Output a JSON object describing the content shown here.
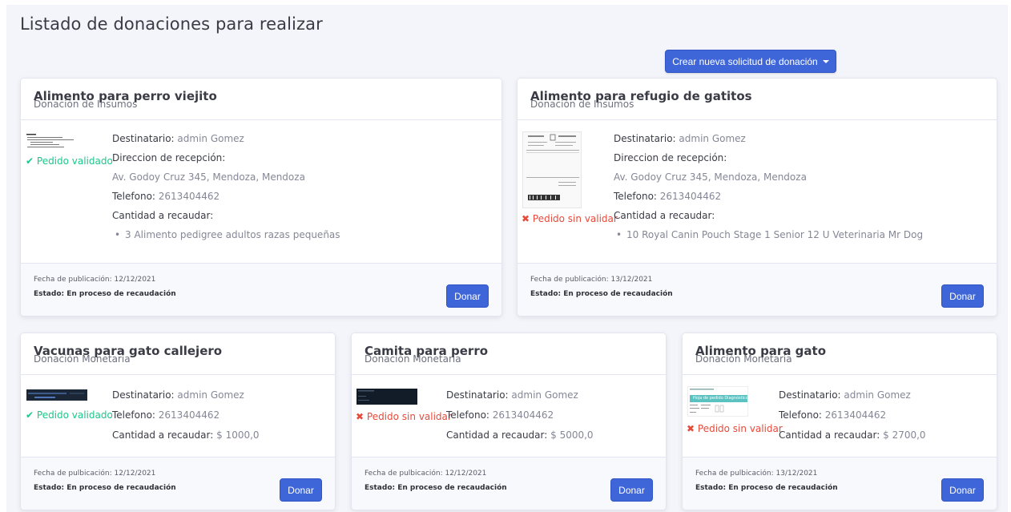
{
  "page": {
    "title": "Listado de donaciones para realizar",
    "create_button_label": "Crear nueva solicitud de donación",
    "donate_label": "Donar",
    "colors": {
      "primary": "#3f66d8",
      "success": "#1cc88a",
      "danger": "#e74a3b",
      "background": "#f3f5fa"
    }
  },
  "cards": [
    {
      "title": "Alimento para perro viejito",
      "subtitle": "Donación de Insumos",
      "status": "Pedido validado",
      "status_type": "success",
      "status_icon": "check-icon",
      "recipient_label": "Destinatario:",
      "recipient": "admin Gomez",
      "address_label": "Direccion de recepción:",
      "address": "Av. Godoy Cruz 345, Mendoza, Mendoza",
      "phone_label": "Telefono:",
      "phone": "2613404462",
      "amount_label": "Cantidad a recaudar:",
      "items": [
        "3 Alimento pedigree adultos razas pequeñas"
      ],
      "date_label": "Fecha de publicación: 12/12/2021",
      "state_label": "Estado: En proceso de recaudación"
    },
    {
      "title": "Alimento para refugio de gatitos",
      "subtitle": "Donación de Insumos",
      "status": "Pedido sin validar",
      "status_type": "danger",
      "status_icon": "x-icon",
      "recipient_label": "Destinatario:",
      "recipient": "admin Gomez",
      "address_label": "Direccion de recepción:",
      "address": "Av. Godoy Cruz 345, Mendoza, Mendoza",
      "phone_label": "Telefono:",
      "phone": "2613404462",
      "amount_label": "Cantidad a recaudar:",
      "items": [
        "10 Royal Canin Pouch Stage 1 Senior 12 U Veterinaria Mr Dog"
      ],
      "date_label": "Fecha de publicación: 13/12/2021",
      "state_label": "Estado: En proceso de recaudación"
    },
    {
      "title": "Vacunas para gato callejero",
      "subtitle": "Donación Monetaria",
      "status": "Pedido validado",
      "status_type": "success",
      "status_icon": "check-icon",
      "recipient_label": "Destinatario:",
      "recipient": "admin Gomez",
      "phone_label": "Telefono:",
      "phone": "2613404462",
      "amount_label": "Cantidad a recaudar:",
      "amount": "$ 1000,0",
      "date_label": "Fecha de pulbicación: 12/12/2021",
      "state_label": "Estado: En proceso de recaudación"
    },
    {
      "title": "Camita para perro",
      "subtitle": "Donación Monetaria",
      "status": "Pedido sin validar",
      "status_type": "danger",
      "status_icon": "x-icon",
      "recipient_label": "Destinatario:",
      "recipient": "admin Gomez",
      "phone_label": "Telefono:",
      "phone": "2613404462",
      "amount_label": "Cantidad a recaudar:",
      "amount": "$ 5000,0",
      "date_label": "Fecha de pulbicación: 12/12/2021",
      "state_label": "Estado: En proceso de recaudación"
    },
    {
      "title": "Alimento para gato",
      "subtitle": "Donación Monetaria",
      "status": "Pedido sin validar",
      "status_type": "danger",
      "status_icon": "x-icon",
      "recipient_label": "Destinatario:",
      "recipient": "admin Gomez",
      "phone_label": "Telefono:",
      "phone": "2613404462",
      "amount_label": "Cantidad a recaudar:",
      "amount": "$ 2700,0",
      "thumb_caption": "Hoja de pedido Diagnóstico",
      "date_label": "Fecha de pulbicación: 13/12/2021",
      "state_label": "Estado: En proceso de recaudación"
    }
  ]
}
